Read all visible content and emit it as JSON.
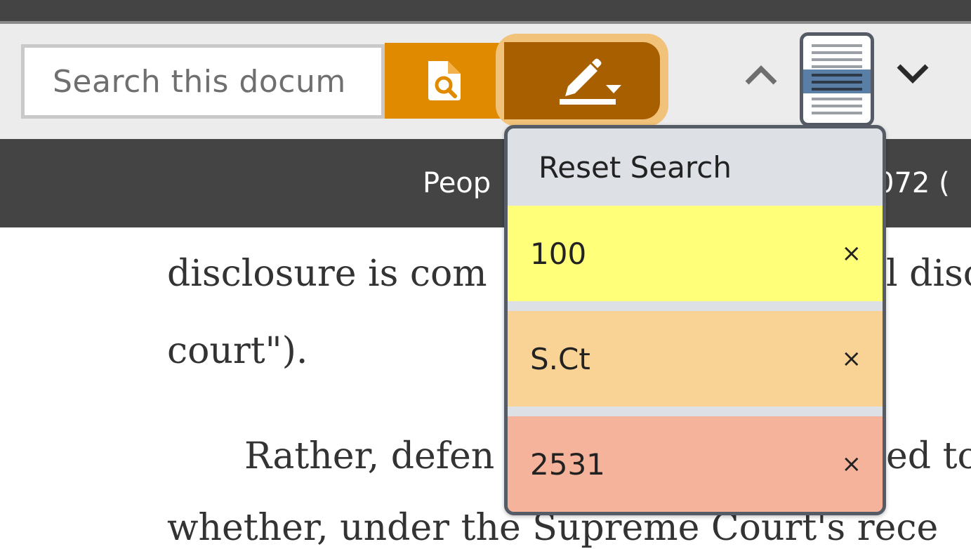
{
  "search": {
    "placeholder": "Search this docum",
    "search_icon": "document-search-icon",
    "highlight_icon": "pen-highlight-icon",
    "dropdown_caret_icon": "caret-down-icon"
  },
  "nav": {
    "prev_icon": "chevron-up-icon",
    "next_icon": "chevron-down-icon",
    "thumbnail_icon": "page-thumbnail-icon"
  },
  "header": {
    "left_text": "Peop",
    "right_text": "072 ("
  },
  "document": {
    "lines": [
      "disclosure is com",
      "l disc",
      "court\").",
      "Rather, defen",
      "ed to",
      "whether, under the Supreme Court's rece"
    ]
  },
  "dropdown": {
    "reset_label": "Reset Search",
    "items": [
      {
        "term": "100",
        "remove": "×",
        "color": "#ffff7a"
      },
      {
        "term": "S.Ct",
        "remove": "×",
        "color": "#f9d396"
      },
      {
        "term": "2531",
        "remove": "×",
        "color": "#f4b39a"
      }
    ]
  },
  "colors": {
    "toolbar_bg": "#ececec",
    "search_button": "#e08a00",
    "highlight_button": "#a85f00",
    "header_bar": "#444444"
  }
}
